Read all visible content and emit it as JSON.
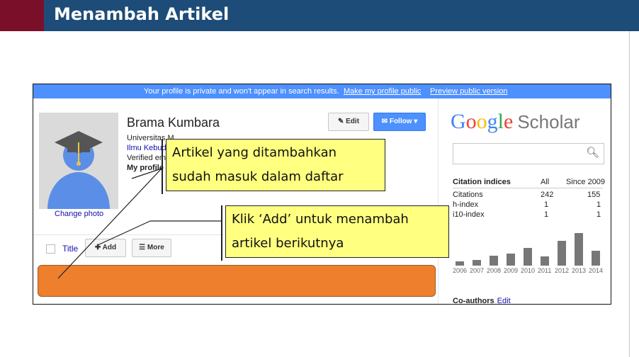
{
  "slide": {
    "title": "Menambah Artikel"
  },
  "banner": {
    "message": "Your profile is private and won't appear in search results.",
    "make_public": "Make my profile public",
    "preview": "Preview public version"
  },
  "profile": {
    "name": "Brama Kumbara",
    "affiliation": "Universitas M",
    "interest": "Ilmu Kebuda",
    "verified": "Verified ema",
    "my_profile": "My profile",
    "change_photo": "Change photo"
  },
  "actions": {
    "edit": "Edit",
    "follow": "Follow"
  },
  "toolbar": {
    "title_col": "Title",
    "add": "Add",
    "more": "More"
  },
  "scholar": {
    "logo_google": [
      "G",
      "o",
      "o",
      "g",
      "l",
      "e"
    ],
    "logo_colors": [
      "#4285f4",
      "#ea4335",
      "#fbbc05",
      "#4285f4",
      "#34a853",
      "#ea4335"
    ],
    "logo_scholar": "Scholar",
    "citation_header": {
      "label": "Citation indices",
      "all": "All",
      "since": "Since 2009"
    },
    "rows": [
      {
        "label": "Citations",
        "all": "242",
        "since": "155"
      },
      {
        "label": "h-index",
        "all": "1",
        "since": "1"
      },
      {
        "label": "i10-index",
        "all": "1",
        "since": "1"
      }
    ],
    "histogram": {
      "years": [
        "2006",
        "2007",
        "2008",
        "2009",
        "2010",
        "2011",
        "2012",
        "2013",
        "2014"
      ],
      "relative_values": [
        0.14,
        0.18,
        0.3,
        0.38,
        0.55,
        0.28,
        0.75,
        1.0,
        0.45
      ]
    },
    "coauthors": "Co-authors",
    "coauthors_edit": "Edit"
  },
  "callouts": {
    "added": [
      "Artikel yang ditambahkan",
      "sudah masuk dalam daftar"
    ],
    "add_next": [
      "Klik ‘Add’ untuk menambah",
      "artikel berikutnya"
    ]
  },
  "colors": {
    "header_bg": "#1e4c78",
    "header_accent": "#7a0f2a",
    "banner_bg": "#4d90fe",
    "highlight_row": "#ee7f2d",
    "callout_bg": "#ffff80"
  }
}
